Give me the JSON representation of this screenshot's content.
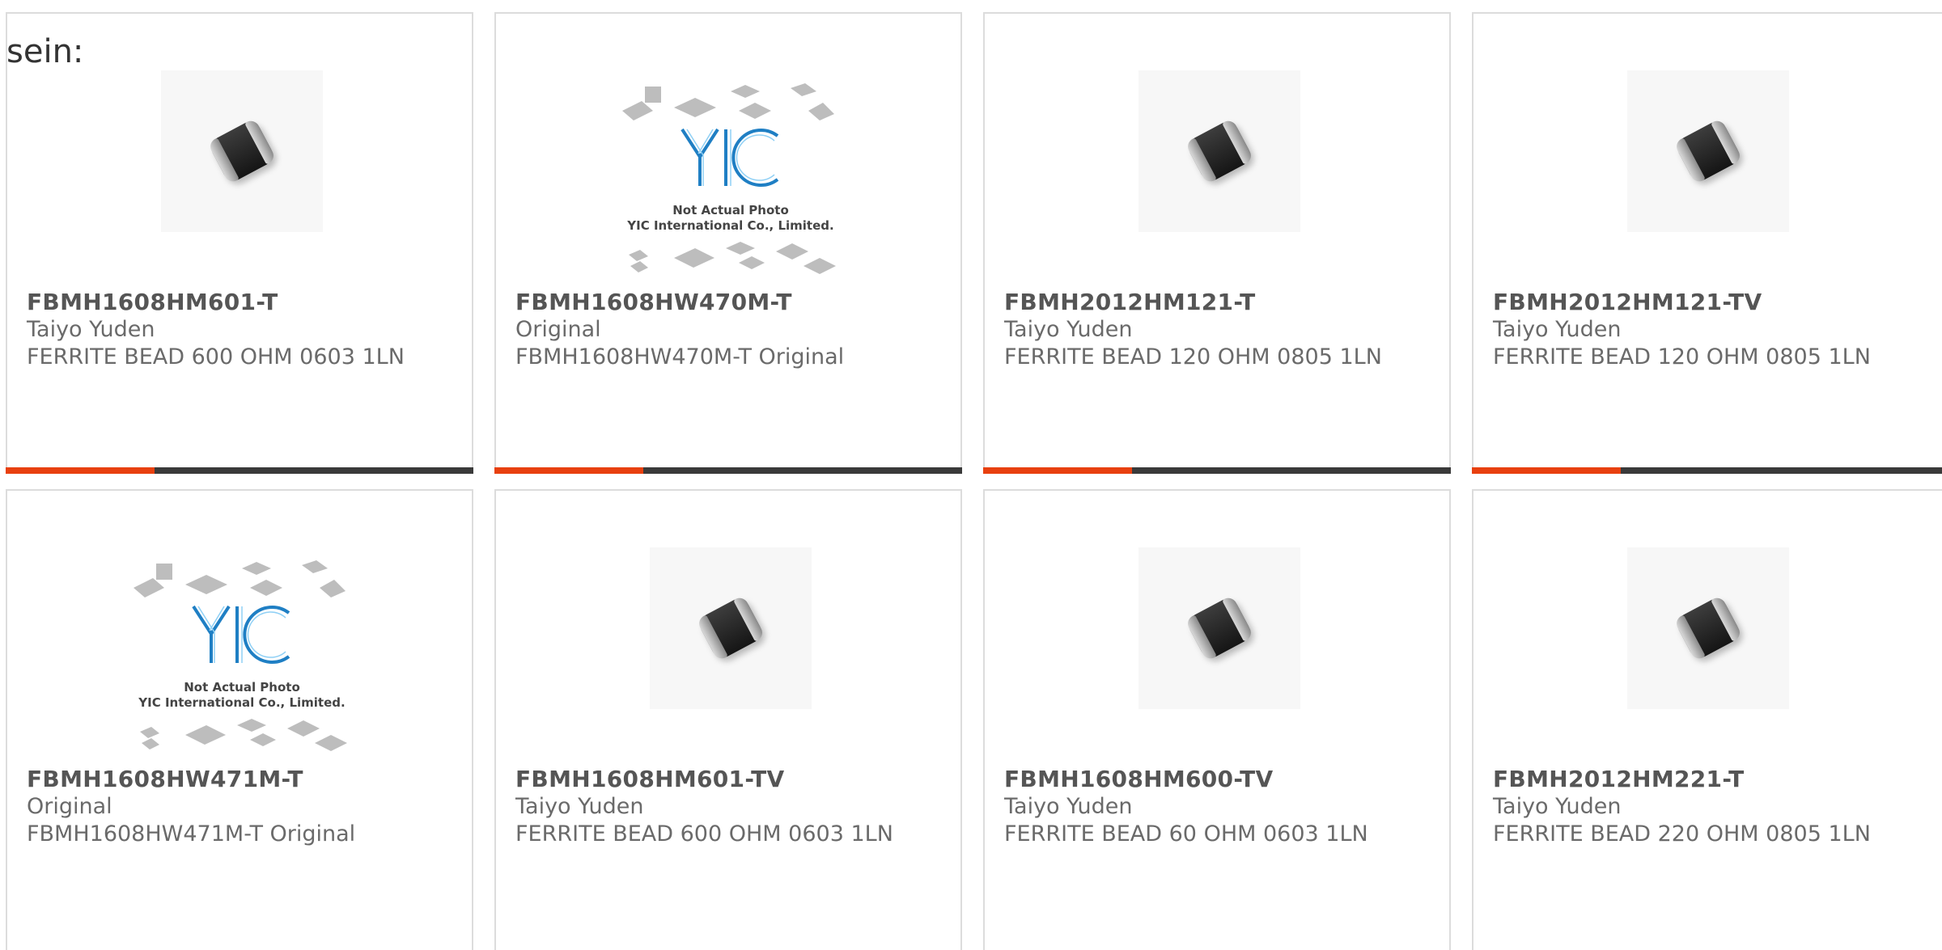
{
  "intro_text": "sein:",
  "colors": {
    "accent": "#e8400f",
    "bar": "#3a3a3a",
    "border": "#dcdcdc"
  },
  "yic_placeholder": {
    "line1": "Not Actual Photo",
    "line2": "YIC International Co., Limited."
  },
  "products": [
    {
      "part": "FBMH1608HM601-T",
      "maker": "Taiyo Yuden",
      "desc": "FERRITE BEAD 600 OHM 0603 1LN",
      "image": "ferrite-bead-icon"
    },
    {
      "part": "FBMH1608HW470M-T",
      "maker": "Original",
      "desc": "FBMH1608HW470M-T Original",
      "image": "yic-placeholder-icon"
    },
    {
      "part": "FBMH2012HM121-T",
      "maker": "Taiyo Yuden",
      "desc": "FERRITE BEAD 120 OHM 0805 1LN",
      "image": "ferrite-bead-icon"
    },
    {
      "part": "FBMH2012HM121-TV",
      "maker": "Taiyo Yuden",
      "desc": "FERRITE BEAD 120 OHM 0805 1LN",
      "image": "ferrite-bead-icon"
    },
    {
      "part": "FBMH1608HW471M-T",
      "maker": "Original",
      "desc": "FBMH1608HW471M-T Original",
      "image": "yic-placeholder-icon"
    },
    {
      "part": "FBMH1608HM601-TV",
      "maker": "Taiyo Yuden",
      "desc": "FERRITE BEAD 600 OHM 0603 1LN",
      "image": "ferrite-bead-icon"
    },
    {
      "part": "FBMH1608HM600-TV",
      "maker": "Taiyo Yuden",
      "desc": "FERRITE BEAD 60 OHM 0603 1LN",
      "image": "ferrite-bead-icon"
    },
    {
      "part": "FBMH2012HM221-T",
      "maker": "Taiyo Yuden",
      "desc": "FERRITE BEAD 220 OHM 0805 1LN",
      "image": "ferrite-bead-icon"
    }
  ]
}
